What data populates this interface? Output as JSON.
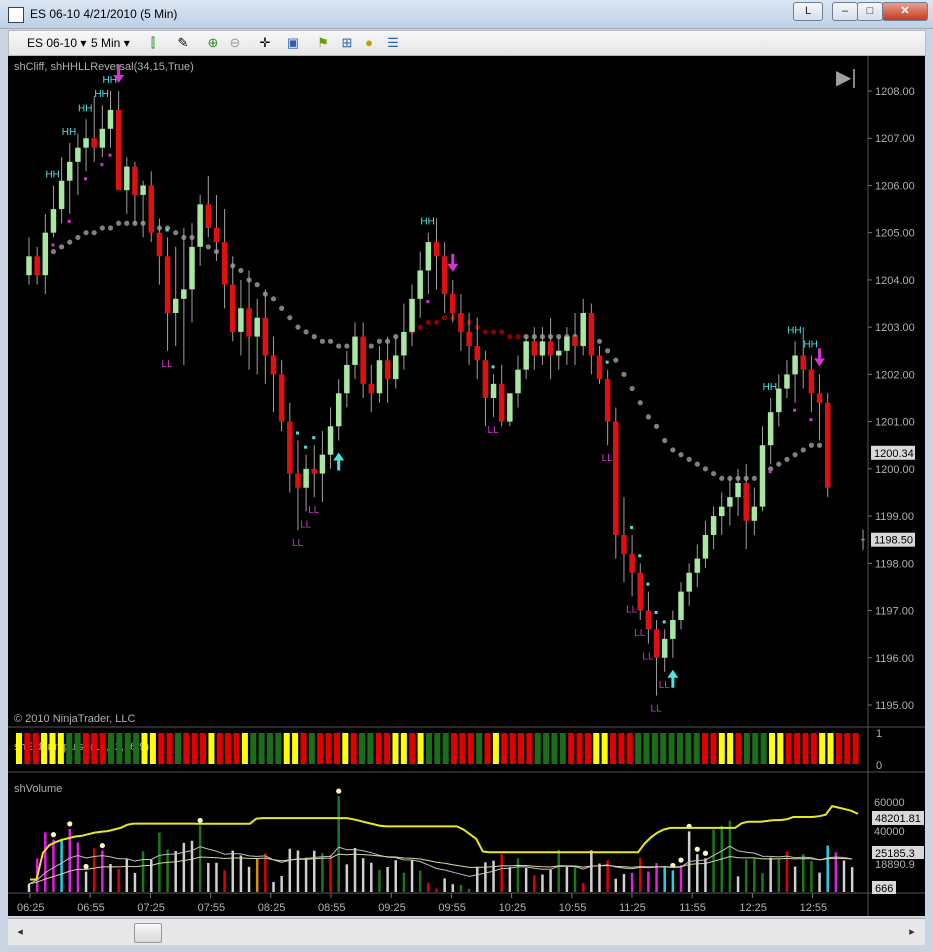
{
  "window": {
    "title": "ES 06-10  4/21/2010 (5 Min)",
    "lang_button": "L",
    "minimize": "–",
    "maximize": "□",
    "close": "✕"
  },
  "toolbar": {
    "instrument": "ES 06-10",
    "interval": "5 Min",
    "dropdown_glyph": "▾",
    "icons": [
      "candlestick-icon",
      "drawing-pen-icon",
      "zoom-in-icon",
      "zoom-out-icon",
      "crosshair-icon",
      "properties-icon",
      "strategy-icon",
      "indicators-icon",
      "market-analyzer-icon",
      "data-box-icon"
    ]
  },
  "colors": {
    "background": "#000000",
    "up_candle": "#a8e6a1",
    "down_candle": "#e01010",
    "hh_label": "#4fe3e3",
    "ll_label": "#d236d2",
    "ema_gray": "#808080",
    "ema_red": "#8b0000",
    "volume_avg": "#e8e820",
    "volume_slow": "#c0c0c0",
    "volume_fast": "#d8d8a0",
    "impulse_yellow": "#ffff00",
    "impulse_red": "#e00000",
    "impulse_green": "#1a6e1a",
    "axis_text": "#b0b0b0"
  },
  "price_panel": {
    "indicator_label": "shCliff, shHHLLReversal(34,15,True)",
    "copyright": "© 2010 NinjaTrader, LLC",
    "y_ticks": [
      "1208.00",
      "1207.00",
      "1206.00",
      "1205.00",
      "1204.00",
      "1203.00",
      "1202.00",
      "1201.00",
      "1200.00",
      "1199.00",
      "1198.00",
      "1197.00",
      "1196.00",
      "1195.00"
    ],
    "last_price_label": "1200.34",
    "crosshair_price_label": "1198.50",
    "hh_text": "HH",
    "ll_text": "LL",
    "play_glyph": "▶|"
  },
  "impulse_panel": {
    "label": "shElderImpulse(13,12,26,9)",
    "y_ticks": [
      "1",
      "0"
    ]
  },
  "volume_panel": {
    "label": "shVolume",
    "y_ticks": [
      "60000",
      "40000"
    ],
    "value_labels": [
      "48201.81",
      "25185.3",
      "18890.9",
      "666"
    ]
  },
  "x_axis": {
    "ticks": [
      "06:25",
      "06:55",
      "07:25",
      "07:55",
      "08:25",
      "08:55",
      "09:25",
      "09:55",
      "10:25",
      "10:55",
      "11:25",
      "11:55",
      "12:25",
      "12:55"
    ]
  },
  "chart_data": {
    "type": "candlestick",
    "instrument": "ES 06-10",
    "interval": "5 Min",
    "date": "4/21/2010",
    "ylim": [
      1194.7,
      1208.6
    ],
    "candles": [
      [
        1204.1,
        1204.9,
        1203.9,
        1204.5
      ],
      [
        1204.5,
        1204.7,
        1203.9,
        1204.1
      ],
      [
        1204.1,
        1205.4,
        1203.7,
        1205.0
      ],
      [
        1205.0,
        1206.0,
        1204.9,
        1205.5
      ],
      [
        1205.5,
        1206.6,
        1205.2,
        1206.1
      ],
      [
        1206.1,
        1206.9,
        1205.4,
        1206.5
      ],
      [
        1206.5,
        1207.1,
        1205.8,
        1206.8
      ],
      [
        1206.8,
        1207.4,
        1206.3,
        1207.0
      ],
      [
        1207.0,
        1207.9,
        1206.5,
        1206.8
      ],
      [
        1206.8,
        1207.7,
        1206.6,
        1207.2
      ],
      [
        1207.2,
        1208.0,
        1206.8,
        1207.6
      ],
      [
        1207.6,
        1208.0,
        1206.4,
        1205.9
      ],
      [
        1205.9,
        1206.6,
        1205.4,
        1206.4
      ],
      [
        1206.4,
        1206.5,
        1205.2,
        1205.8
      ],
      [
        1205.8,
        1206.1,
        1204.9,
        1206.0
      ],
      [
        1206.0,
        1206.3,
        1204.8,
        1205.0
      ],
      [
        1205.0,
        1205.3,
        1203.9,
        1204.5
      ],
      [
        1204.5,
        1204.9,
        1202.5,
        1203.3
      ],
      [
        1203.3,
        1204.7,
        1202.6,
        1203.6
      ],
      [
        1203.6,
        1205.1,
        1202.2,
        1203.8
      ],
      [
        1203.8,
        1205.2,
        1203.1,
        1204.7
      ],
      [
        1204.7,
        1205.8,
        1204.3,
        1205.6
      ],
      [
        1205.6,
        1206.2,
        1204.9,
        1205.1
      ],
      [
        1205.1,
        1205.8,
        1204.4,
        1204.8
      ],
      [
        1204.8,
        1205.5,
        1203.4,
        1203.9
      ],
      [
        1203.9,
        1204.5,
        1202.7,
        1202.9
      ],
      [
        1202.9,
        1204.0,
        1202.4,
        1203.4
      ],
      [
        1203.4,
        1204.2,
        1202.1,
        1202.8
      ],
      [
        1202.8,
        1203.6,
        1202.0,
        1203.2
      ],
      [
        1203.2,
        1203.8,
        1201.8,
        1202.4
      ],
      [
        1202.4,
        1202.8,
        1201.2,
        1202.0
      ],
      [
        1202.0,
        1202.3,
        1200.8,
        1201.0
      ],
      [
        1201.0,
        1201.4,
        1199.5,
        1199.9
      ],
      [
        1199.9,
        1200.6,
        1198.7,
        1199.6
      ],
      [
        1199.6,
        1200.3,
        1199.1,
        1200.0
      ],
      [
        1200.0,
        1200.5,
        1199.4,
        1199.9
      ],
      [
        1199.9,
        1200.8,
        1199.3,
        1200.3
      ],
      [
        1200.3,
        1201.3,
        1200.0,
        1200.9
      ],
      [
        1200.9,
        1201.9,
        1200.6,
        1201.6
      ],
      [
        1201.6,
        1202.5,
        1201.3,
        1202.2
      ],
      [
        1202.2,
        1203.1,
        1201.9,
        1202.8
      ],
      [
        1202.8,
        1203.1,
        1201.5,
        1201.8
      ],
      [
        1201.8,
        1202.2,
        1201.2,
        1201.6
      ],
      [
        1201.6,
        1202.6,
        1201.4,
        1202.3
      ],
      [
        1202.3,
        1202.8,
        1201.4,
        1201.9
      ],
      [
        1201.9,
        1202.8,
        1201.7,
        1202.4
      ],
      [
        1202.4,
        1203.5,
        1202.1,
        1202.9
      ],
      [
        1202.9,
        1203.9,
        1202.6,
        1203.6
      ],
      [
        1203.6,
        1204.6,
        1203.2,
        1204.2
      ],
      [
        1204.2,
        1205.0,
        1203.7,
        1204.8
      ],
      [
        1204.8,
        1205.3,
        1203.8,
        1204.5
      ],
      [
        1204.5,
        1204.8,
        1203.3,
        1203.7
      ],
      [
        1203.7,
        1204.0,
        1203.1,
        1203.3
      ],
      [
        1203.3,
        1203.7,
        1202.5,
        1202.9
      ],
      [
        1202.9,
        1203.3,
        1202.2,
        1202.6
      ],
      [
        1202.6,
        1203.2,
        1201.9,
        1202.3
      ],
      [
        1202.3,
        1202.5,
        1200.9,
        1201.5
      ],
      [
        1201.5,
        1202.0,
        1201.1,
        1201.8
      ],
      [
        1201.8,
        1202.2,
        1200.9,
        1201.0
      ],
      [
        1201.0,
        1201.5,
        1200.9,
        1201.6
      ],
      [
        1201.6,
        1202.4,
        1201.3,
        1202.1
      ],
      [
        1202.1,
        1202.8,
        1201.9,
        1202.7
      ],
      [
        1202.7,
        1203.0,
        1202.1,
        1202.4
      ],
      [
        1202.4,
        1203.0,
        1202.2,
        1202.7
      ],
      [
        1202.7,
        1203.2,
        1201.9,
        1202.4
      ],
      [
        1202.4,
        1202.8,
        1202.1,
        1202.5
      ],
      [
        1202.5,
        1203.0,
        1202.2,
        1202.8
      ],
      [
        1202.8,
        1203.3,
        1202.2,
        1202.6
      ],
      [
        1202.6,
        1203.6,
        1202.4,
        1203.3
      ],
      [
        1203.3,
        1203.5,
        1202.0,
        1202.4
      ],
      [
        1202.4,
        1202.6,
        1201.8,
        1201.9
      ],
      [
        1201.9,
        1202.1,
        1200.5,
        1201.0
      ],
      [
        1201.0,
        1201.3,
        1198.1,
        1198.6
      ],
      [
        1198.6,
        1199.4,
        1197.6,
        1198.2
      ],
      [
        1198.2,
        1198.6,
        1197.3,
        1197.8
      ],
      [
        1197.8,
        1198.0,
        1196.8,
        1197.0
      ],
      [
        1197.0,
        1197.4,
        1196.3,
        1196.6
      ],
      [
        1196.6,
        1196.8,
        1195.2,
        1196.0
      ],
      [
        1196.0,
        1196.6,
        1195.7,
        1196.4
      ],
      [
        1196.4,
        1197.0,
        1196.0,
        1196.8
      ],
      [
        1196.8,
        1197.6,
        1196.6,
        1197.4
      ],
      [
        1197.4,
        1198.0,
        1197.1,
        1197.8
      ],
      [
        1197.8,
        1198.4,
        1197.5,
        1198.1
      ],
      [
        1198.1,
        1198.9,
        1197.9,
        1198.6
      ],
      [
        1198.6,
        1199.2,
        1198.3,
        1199.0
      ],
      [
        1199.0,
        1199.5,
        1198.6,
        1199.2
      ],
      [
        1199.2,
        1199.8,
        1198.8,
        1199.4
      ],
      [
        1199.4,
        1200.0,
        1199.0,
        1199.7
      ],
      [
        1199.7,
        1200.1,
        1198.3,
        1198.9
      ],
      [
        1198.9,
        1199.6,
        1198.6,
        1199.2
      ],
      [
        1199.2,
        1200.9,
        1199.1,
        1200.5
      ],
      [
        1200.5,
        1201.5,
        1200.1,
        1201.2
      ],
      [
        1201.2,
        1202.0,
        1200.9,
        1201.7
      ],
      [
        1201.7,
        1202.3,
        1201.5,
        1202.0
      ],
      [
        1202.0,
        1202.7,
        1201.4,
        1202.4
      ],
      [
        1202.4,
        1203.0,
        1201.7,
        1202.1
      ],
      [
        1202.1,
        1202.4,
        1201.2,
        1201.6
      ],
      [
        1201.6,
        1202.0,
        1200.6,
        1201.4
      ],
      [
        1201.4,
        1201.6,
        1199.4,
        1199.6
      ]
    ],
    "ema": [
      1204.3,
      1204.4,
      1204.5,
      1204.6,
      1204.7,
      1204.8,
      1204.9,
      1205.0,
      1205.0,
      1205.1,
      1205.1,
      1205.2,
      1205.2,
      1205.2,
      1205.2,
      1205.2,
      1205.1,
      1205.1,
      1205.0,
      1204.9,
      1204.9,
      1204.8,
      1204.7,
      1204.6,
      1204.5,
      1204.3,
      1204.2,
      1204.0,
      1203.9,
      1203.7,
      1203.6,
      1203.4,
      1203.2,
      1203.0,
      1202.9,
      1202.8,
      1202.7,
      1202.7,
      1202.6,
      1202.6,
      1202.6,
      1202.6,
      1202.6,
      1202.7,
      1202.7,
      1202.8,
      1202.8,
      1202.9,
      1203.0,
      1203.1,
      1203.1,
      1203.2,
      1203.2,
      1203.2,
      1203.1,
      1203.0,
      1202.9,
      1202.9,
      1202.9,
      1202.8,
      1202.8,
      1202.8,
      1202.8,
      1202.8,
      1202.8,
      1202.8,
      1202.8,
      1202.8,
      1202.8,
      1202.8,
      1202.7,
      1202.5,
      1202.3,
      1202.0,
      1201.7,
      1201.4,
      1201.1,
      1200.9,
      1200.6,
      1200.4,
      1200.3,
      1200.2,
      1200.1,
      1200.0,
      1199.9,
      1199.8,
      1199.8,
      1199.8,
      1199.8,
      1199.8,
      1199.9,
      1200.0,
      1200.1,
      1200.2,
      1200.3,
      1200.4,
      1200.5,
      1200.5,
      1200.4
    ],
    "ema_red_range": [
      47,
      60
    ],
    "hh_bars": [
      3,
      5,
      7,
      9,
      10,
      49,
      91,
      94,
      96
    ],
    "ll_bars": [
      17,
      33,
      34,
      35,
      57,
      71,
      74,
      75,
      76,
      77,
      78
    ],
    "down_arrow_bars": [
      11,
      52,
      97
    ],
    "up_arrow_bars": [
      38,
      79
    ],
    "impulse": "YRRYYYGGRRRGGGGYYRRGRRRYRRRYGGGGYYRGRRRYRGGRRYYRYGGGRRRGRYRRRRGGGGRRRYYRRRGGGGGGGGRRYYRGGGYYRRRRYYRRR",
    "volume": [
      5200,
      21500,
      38200,
      33500,
      34000,
      40400,
      31700,
      13100,
      27900,
      26500,
      17900,
      14800,
      21100,
      12200,
      26100,
      20700,
      38100,
      27200,
      26200,
      31400,
      32800,
      42600,
      18600,
      18700,
      13900,
      26500,
      23400,
      16100,
      21100,
      24800,
      6400,
      10200,
      27700,
      26600,
      22000,
      26400,
      24900,
      23900,
      61400,
      17700,
      28200,
      21600,
      18700,
      14200,
      16000,
      20300,
      12300,
      20200,
      13700,
      6000,
      2300,
      8700,
      5000,
      4500,
      2100,
      16200,
      19000,
      20100,
      24200,
      15900,
      21600,
      15400,
      10700,
      11200,
      14200,
      27000,
      16000,
      15800,
      5800,
      26700,
      18200,
      20300,
      8500,
      11500,
      12300,
      21800,
      13100,
      18500,
      16600,
      13800,
      17200,
      38800,
      24200,
      21600,
      40000,
      42400,
      45500,
      10000,
      20800,
      21600,
      12100,
      22000,
      20800,
      25800,
      16300,
      24300,
      19800,
      12400,
      29700,
      25400,
      20200,
      15900
    ],
    "volume_colors": "WMMMCMMWRMWRWWGWGGWWWGWWRWWWORWWWWWWGRGWWWWGWWGWGRRWWGGWWWRWGWRWWGWGRWWRWWMRMMCCMWWWGGGWGGGWGRWGGWCMW",
    "volume_avg_line": [
      8000,
      8000,
      25000,
      30000,
      32000,
      33500,
      34500,
      35500,
      36000,
      37000,
      38000,
      38500,
      39000,
      40000,
      41000,
      43000,
      43800,
      43800,
      43800,
      43800,
      43800,
      43800,
      43800,
      43800,
      43800,
      43800,
      43700,
      43700,
      43700,
      43700,
      43700,
      43700,
      43700,
      43700,
      43700,
      47000,
      47300,
      47300,
      47300,
      47300,
      47300,
      47300,
      47300,
      47300,
      47300,
      47300,
      47300,
      47300,
      47300,
      47300,
      46500,
      45500,
      44500,
      43500,
      42500,
      42000,
      42000,
      42000,
      42000,
      42000,
      42000,
      42000,
      42000,
      42000,
      42000,
      42000,
      42000,
      40000,
      37000,
      34000,
      26000,
      25500,
      25500,
      25500,
      25500,
      25500,
      25500,
      25500,
      25500,
      25500,
      25500,
      25500,
      25500,
      25500,
      25500,
      25500,
      25500,
      25500,
      25500,
      25500,
      25500,
      25500,
      25500,
      25500,
      25500,
      31000,
      35000,
      38000,
      40000,
      41000,
      41000,
      41000,
      41000,
      41000,
      41000,
      41000,
      41000,
      41000,
      41000,
      41000,
      44000,
      45000,
      45000,
      45000,
      45500,
      46000,
      46000,
      46500,
      48000,
      48000,
      48000,
      48000,
      48500,
      49500,
      55000,
      54000,
      53000,
      52000,
      50000
    ],
    "dot_bars": [
      3,
      5,
      7,
      9,
      21,
      38,
      79,
      80,
      81,
      82,
      83,
      106
    ]
  }
}
